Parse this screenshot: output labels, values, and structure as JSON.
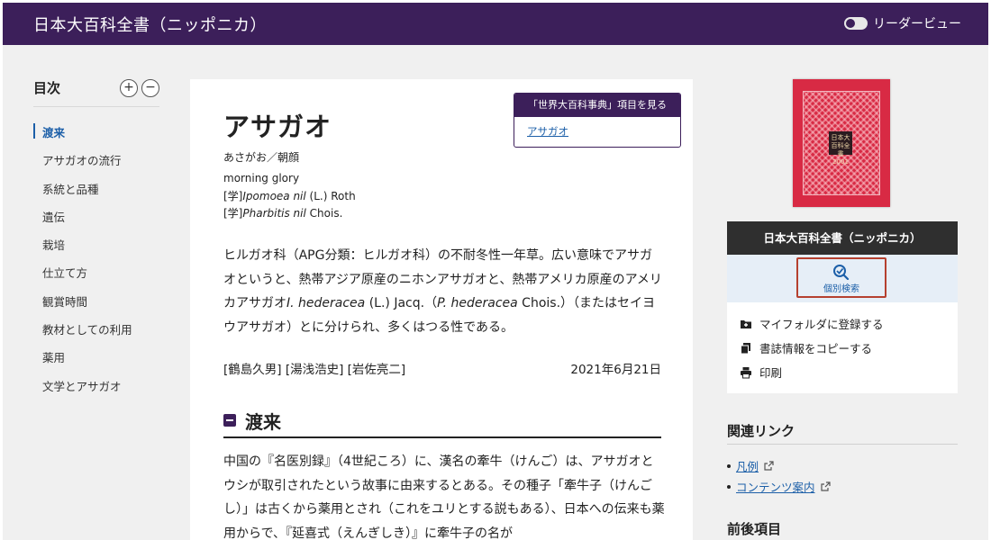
{
  "header": {
    "title": "日本大百科全書（ニッポニカ）",
    "reader_view_label": "リーダービュー"
  },
  "toc": {
    "title": "目次",
    "expand_label": "+",
    "collapse_label": "−",
    "items": [
      {
        "label": "渡来",
        "active": true
      },
      {
        "label": "アサガオの流行"
      },
      {
        "label": "系統と品種"
      },
      {
        "label": "遺伝"
      },
      {
        "label": "栽培"
      },
      {
        "label": "仕立て方"
      },
      {
        "label": "観賞時間"
      },
      {
        "label": "教材としての利用"
      },
      {
        "label": "薬用"
      },
      {
        "label": "文学とアサガオ"
      }
    ]
  },
  "article": {
    "ref_box_title": "「世界大百科事典」項目を見る",
    "ref_box_link": "アサガオ",
    "title": "アサガオ",
    "reading": "あさがお／朝顔",
    "english": "morning glory",
    "sci1_prefix": "[学]",
    "sci1_name": "Ipomoea nil",
    "sci1_author": " (L.) Roth",
    "sci2_prefix": "[学]",
    "sci2_name": "Pharbitis nil",
    "sci2_author": " Chois.",
    "body_p1": "ヒルガオ科（APG分類：ヒルガオ科）の不耐冬性一年草。広い意味でアサガオというと、熱帯アジア原産のニホンアサガオと、熱帯アメリカ原産のアメリカアサガオ",
    "body_p1_sci": "I. hederacea",
    "body_p1_b": " (L.) Jacq.（",
    "body_p1_sci2": "P. hederacea",
    "body_p1_c": " Chois.）（またはセイヨウアサガオ）とに分けられ、多くはつる性である。",
    "authors": "[鶴島久男] [湯浅浩史] [岩佐亮二]",
    "date": "2021年6月21日",
    "section_title": "渡来",
    "section_text": "中国の『名医別録』（4世紀ころ）に、漢名の牽牛（けんご）は、アサガオとウシが取引されたという故事に由来するとある。その種子「牽牛子（けんごし）」は古くから薬用とされ（これをユリとする説もある）、日本への伝来も薬用からで、『延喜式（えんぎしき）』に牽牛子の名が"
  },
  "sidebar": {
    "cover_label": "日本大百科全書 2001",
    "book_title": "日本大百科全書（ニッポニカ）",
    "search_label": "個別検索",
    "actions": [
      {
        "label": "マイフォルダに登録する",
        "icon": "folder-plus-icon"
      },
      {
        "label": "書誌情報をコピーする",
        "icon": "copy-icon"
      },
      {
        "label": "印刷",
        "icon": "printer-icon"
      }
    ],
    "related_title": "関連リンク",
    "related_links": [
      {
        "label": "凡例"
      },
      {
        "label": "コンテンツ案内"
      }
    ],
    "prevnext_title": "前後項目"
  },
  "colors": {
    "brand": "#3c1f5a",
    "link": "#1c5fa8",
    "highlight_border": "#b5402f",
    "cover": "#d82a44"
  }
}
